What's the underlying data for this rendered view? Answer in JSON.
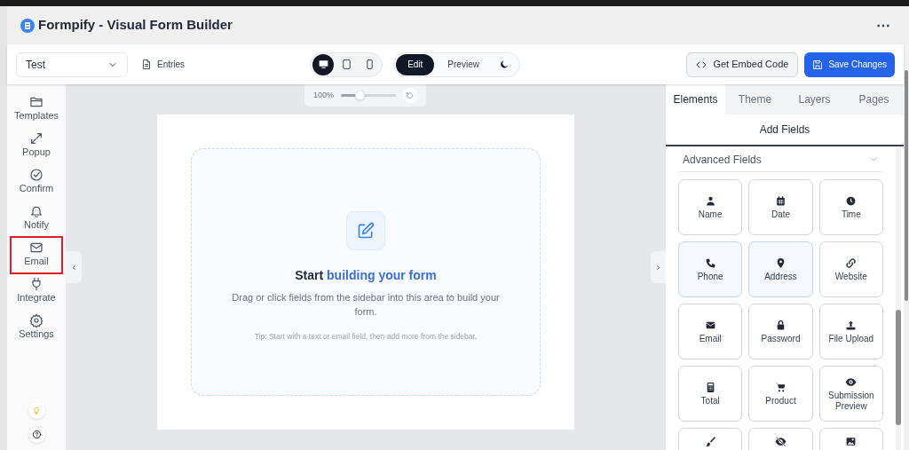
{
  "window": {
    "title": "Formpify - Visual Form Builder",
    "menu_glyph": "⋯"
  },
  "toolbar": {
    "form_select": {
      "value": "Test"
    },
    "entries_link": "Entries",
    "devices": [
      {
        "kind": "desktop",
        "selected": true
      },
      {
        "kind": "tablet",
        "selected": false
      },
      {
        "kind": "mobile",
        "selected": false
      }
    ],
    "modes": [
      {
        "kind": "text",
        "label": "Edit",
        "selected": true
      },
      {
        "kind": "text",
        "label": "Preview",
        "selected": false
      },
      {
        "kind": "theme",
        "selected": false
      }
    ],
    "embed_button": "Get Embed Code",
    "save_button": "Save Changes"
  },
  "sidebar": {
    "items": [
      {
        "kind": "folder",
        "label": "Templates",
        "outlined": false
      },
      {
        "kind": "expand",
        "label": "Popup",
        "outlined": false
      },
      {
        "kind": "check",
        "label": "Confirm",
        "outlined": false
      },
      {
        "kind": "bell",
        "label": "Notify",
        "outlined": false
      },
      {
        "kind": "mail",
        "label": "Email",
        "outlined": true
      },
      {
        "kind": "plug",
        "label": "Integrate",
        "outlined": false
      },
      {
        "kind": "gear",
        "label": "Settings",
        "outlined": false
      }
    ]
  },
  "zoom": {
    "reading": "100%",
    "level": 0.34
  },
  "canvas": {
    "heading": "Start **building your form**",
    "description": "Drag or click fields from the sidebar into this area to build your form.",
    "tip": "Tip: Start with a text or email field, then add more from the sidebar."
  },
  "panel": {
    "tabs": [
      {
        "label": "Elements",
        "selected": true
      },
      {
        "label": "Theme",
        "selected": false
      },
      {
        "label": "Layers",
        "selected": false
      },
      {
        "label": "Pages",
        "selected": false
      }
    ],
    "section_title": "Add Fields",
    "group": {
      "title": "Advanced Fields",
      "expanded": true
    },
    "fields": [
      {
        "kind": "user",
        "label": "Name",
        "highlighted": false
      },
      {
        "kind": "calendar",
        "label": "Date",
        "highlighted": false
      },
      {
        "kind": "clock",
        "label": "Time",
        "highlighted": false
      },
      {
        "kind": "phone",
        "label": "Phone",
        "highlighted": true
      },
      {
        "kind": "pin",
        "label": "Address",
        "highlighted": true
      },
      {
        "kind": "link",
        "label": "Website",
        "highlighted": false
      },
      {
        "kind": "envelope",
        "label": "Email",
        "highlighted": false
      },
      {
        "kind": "lock",
        "label": "Password",
        "highlighted": false
      },
      {
        "kind": "upload",
        "label": "File Upload",
        "highlighted": false
      },
      {
        "kind": "calculator",
        "label": "Total",
        "highlighted": false
      },
      {
        "kind": "cart",
        "label": "Product",
        "highlighted": false
      },
      {
        "kind": "eye",
        "label": "Submission Preview",
        "highlighted": false
      },
      {
        "kind": "brush",
        "highlighted": false
      },
      {
        "kind": "eye-slash",
        "highlighted": false
      },
      {
        "kind": "image",
        "highlighted": false
      }
    ]
  }
}
